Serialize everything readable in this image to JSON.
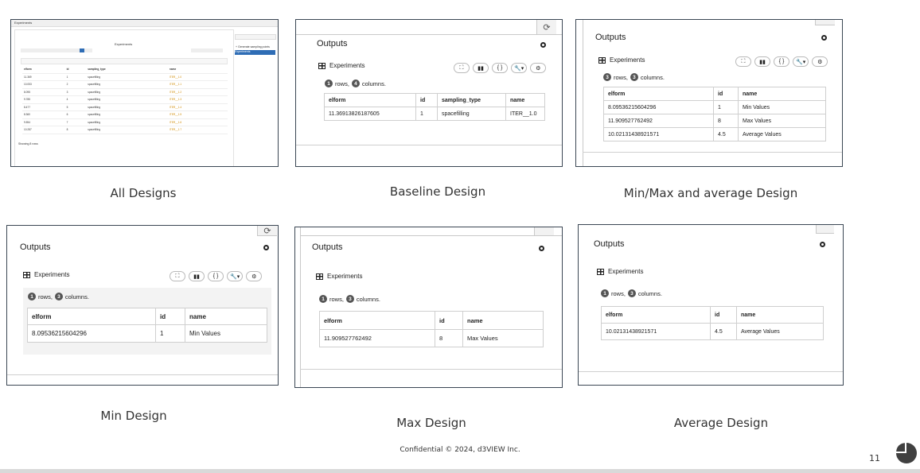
{
  "captions": {
    "all": "All Designs",
    "baseline": "Baseline Design",
    "minmax": "Min/Max and average Design",
    "min": "Min Design",
    "max": "Max Design",
    "average": "Average Design"
  },
  "common": {
    "outputs": "Outputs",
    "experiments": "Experiments",
    "rows_word": "rows,",
    "columns_word": "columns.",
    "tool_expand": "⛶",
    "tool_chart": "▮▮",
    "tool_code": "{ }",
    "tool_wrench": "🔧▾",
    "tool_gear": "⚙",
    "refresh": "⟳"
  },
  "baseline": {
    "rows": "1",
    "cols": "4",
    "headers": [
      "elform",
      "id",
      "sampling_type",
      "name"
    ],
    "row": [
      "11.36913826187605",
      "1",
      "spacefilling",
      "ITER__1.0"
    ]
  },
  "minmax": {
    "rows": "3",
    "cols": "3",
    "headers": [
      "elform",
      "id",
      "name"
    ],
    "rows_data": [
      [
        "8.09536215604296",
        "1",
        "Min Values"
      ],
      [
        "11.909527762492",
        "8",
        "Max Values"
      ],
      [
        "10.02131438921571",
        "4.5",
        "Average Values"
      ]
    ]
  },
  "min": {
    "rows": "1",
    "cols": "3",
    "headers": [
      "elform",
      "id",
      "name"
    ],
    "row": [
      "8.09536215604296",
      "1",
      "Min Values"
    ]
  },
  "max": {
    "rows": "1",
    "cols": "3",
    "headers": [
      "elform",
      "id",
      "name"
    ],
    "row": [
      "11.909527762492",
      "8",
      "Max Values"
    ]
  },
  "average": {
    "rows": "1",
    "cols": "3",
    "headers": [
      "elform",
      "id",
      "name"
    ],
    "row": [
      "10.02131438921571",
      "4.5",
      "Average Values"
    ]
  },
  "mini": {
    "title": "Experiments",
    "section": "Experiments",
    "headers": [
      "elform",
      "id",
      "sampling_type",
      "name"
    ],
    "rows": [
      [
        "11.369",
        "1",
        "spacefilling",
        "ITER__1.0"
      ],
      [
        "10.053",
        "2",
        "spacefilling",
        "ITER__1.1"
      ],
      [
        "8.095",
        "3",
        "spacefilling",
        "ITER__1.2"
      ],
      [
        "9.785",
        "4",
        "spacefilling",
        "ITER__1.3"
      ],
      [
        "8.477",
        "5",
        "spacefilling",
        "ITER__1.4"
      ],
      [
        "8.360",
        "6",
        "spacefilling",
        "ITER__1.5"
      ],
      [
        "9.554",
        "7",
        "spacefilling",
        "ITER__1.6"
      ],
      [
        "10.287",
        "8",
        "spacefilling",
        "ITER__1.7"
      ]
    ],
    "footer": "Showing 8 rows",
    "side_item_1": "+ Generate sampling points",
    "side_item_2": "Experiments"
  },
  "footer": {
    "confidential": "Confidential © 2024, d3VIEW Inc.",
    "page": "11"
  },
  "colors": {
    "border": "#3a4653",
    "badge": "#555555",
    "mini_accent": "#2f6db5"
  }
}
